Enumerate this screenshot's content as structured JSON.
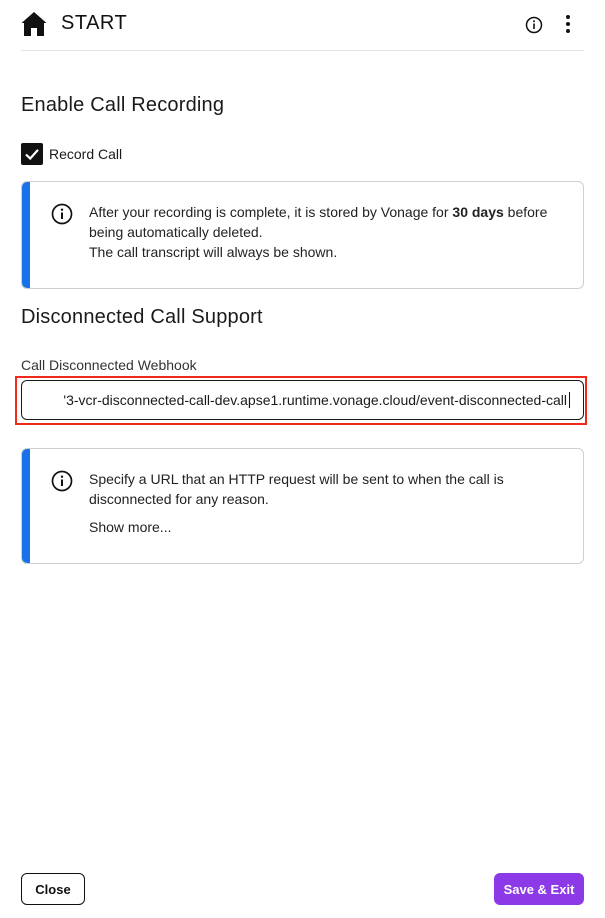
{
  "header": {
    "icon": "home-icon",
    "title": "START",
    "actions": [
      "info-icon",
      "more-vertical-icon"
    ]
  },
  "recording": {
    "heading": "Enable Call Recording",
    "checkbox_label": "Record Call",
    "checked": true,
    "note": {
      "icon": "info-icon",
      "text_before": "After your recording is complete, it is stored by Vonage for ",
      "text_bold": "30 days",
      "text_after": " before being automatically deleted.",
      "line2": "The call transcript will always be shown."
    }
  },
  "disconnected": {
    "heading": "Disconnected Call Support",
    "field_label": "Call Disconnected Webhook",
    "field_value": "'3-vcr-disconnected-call-dev.apse1.runtime.vonage.cloud/event-disconnected-call",
    "note": {
      "icon": "info-icon",
      "text": "Specify a URL that an HTTP request will be sent to when the call is disconnected for any reason.",
      "link": "Show more..."
    }
  },
  "footer": {
    "close_label": "Close",
    "save_label": "Save & Exit"
  },
  "colors": {
    "accent": "#8c3ae8",
    "info_bar": "#1a72e8",
    "highlight": "#f0291a"
  }
}
